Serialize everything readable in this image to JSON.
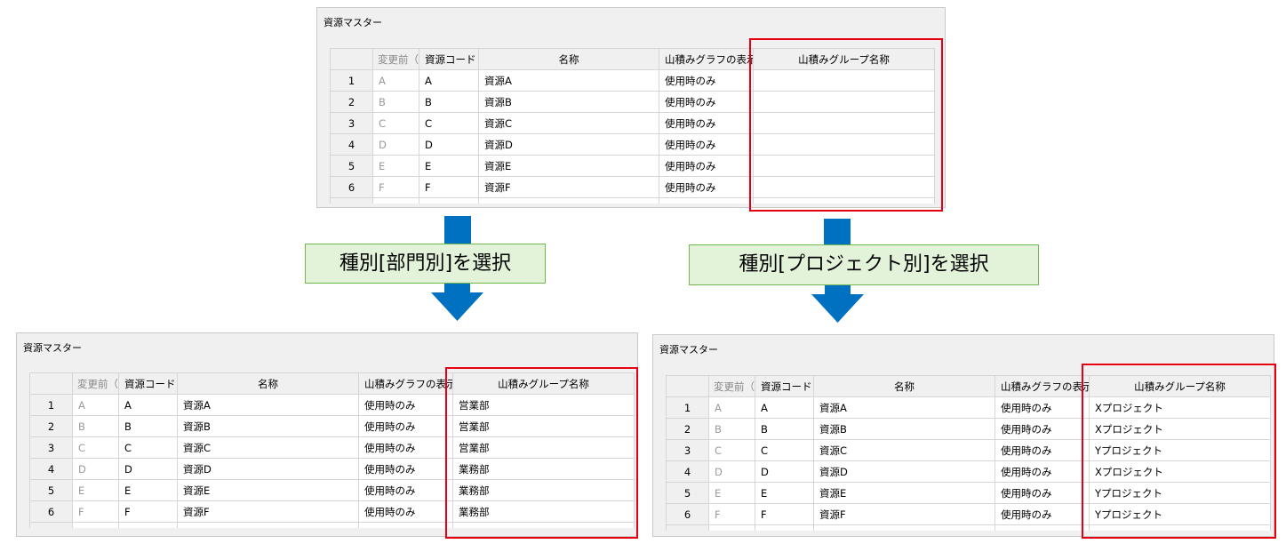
{
  "panels": {
    "top": {
      "title": "資源マスター",
      "headers": [
        "変更前（",
        "資源コード",
        "名称",
        "山積みグラフの表示",
        "山積みグループ名称"
      ],
      "rows": [
        {
          "num": "1",
          "before": "A",
          "code": "A",
          "name": "資源A",
          "display": "使用時のみ",
          "group": ""
        },
        {
          "num": "2",
          "before": "B",
          "code": "B",
          "name": "資源B",
          "display": "使用時のみ",
          "group": ""
        },
        {
          "num": "3",
          "before": "C",
          "code": "C",
          "name": "資源C",
          "display": "使用時のみ",
          "group": ""
        },
        {
          "num": "4",
          "before": "D",
          "code": "D",
          "name": "資源D",
          "display": "使用時のみ",
          "group": ""
        },
        {
          "num": "5",
          "before": "E",
          "code": "E",
          "name": "資源E",
          "display": "使用時のみ",
          "group": ""
        },
        {
          "num": "6",
          "before": "F",
          "code": "F",
          "name": "資源F",
          "display": "使用時のみ",
          "group": ""
        }
      ]
    },
    "left": {
      "title": "資源マスター",
      "headers": [
        "変更前（",
        "資源コード",
        "名称",
        "山積みグラフの表示",
        "山積みグループ名称"
      ],
      "rows": [
        {
          "num": "1",
          "before": "A",
          "code": "A",
          "name": "資源A",
          "display": "使用時のみ",
          "group": "営業部"
        },
        {
          "num": "2",
          "before": "B",
          "code": "B",
          "name": "資源B",
          "display": "使用時のみ",
          "group": "営業部"
        },
        {
          "num": "3",
          "before": "C",
          "code": "C",
          "name": "資源C",
          "display": "使用時のみ",
          "group": "営業部"
        },
        {
          "num": "4",
          "before": "D",
          "code": "D",
          "name": "資源D",
          "display": "使用時のみ",
          "group": "業務部"
        },
        {
          "num": "5",
          "before": "E",
          "code": "E",
          "name": "資源E",
          "display": "使用時のみ",
          "group": "業務部"
        },
        {
          "num": "6",
          "before": "F",
          "code": "F",
          "name": "資源F",
          "display": "使用時のみ",
          "group": "業務部"
        }
      ]
    },
    "right": {
      "title": "資源マスター",
      "headers": [
        "変更前（",
        "資源コード",
        "名称",
        "山積みグラフの表示",
        "山積みグループ名称"
      ],
      "rows": [
        {
          "num": "1",
          "before": "A",
          "code": "A",
          "name": "資源A",
          "display": "使用時のみ",
          "group": "Xプロジェクト"
        },
        {
          "num": "2",
          "before": "B",
          "code": "B",
          "name": "資源B",
          "display": "使用時のみ",
          "group": "Xプロジェクト"
        },
        {
          "num": "3",
          "before": "C",
          "code": "C",
          "name": "資源C",
          "display": "使用時のみ",
          "group": "Yプロジェクト"
        },
        {
          "num": "4",
          "before": "D",
          "code": "D",
          "name": "資源D",
          "display": "使用時のみ",
          "group": "Xプロジェクト"
        },
        {
          "num": "5",
          "before": "E",
          "code": "E",
          "name": "資源E",
          "display": "使用時のみ",
          "group": "Yプロジェクト"
        },
        {
          "num": "6",
          "before": "F",
          "code": "F",
          "name": "資源F",
          "display": "使用時のみ",
          "group": "Yプロジェクト"
        }
      ]
    }
  },
  "labels": {
    "left": "種別[部門別]を選択",
    "right": "種別[プロジェクト別]を選択"
  },
  "colors": {
    "highlight": "#e60012",
    "arrow": "#0070c0",
    "label_bg": "#e3f3d9",
    "label_border": "#72b64e"
  }
}
